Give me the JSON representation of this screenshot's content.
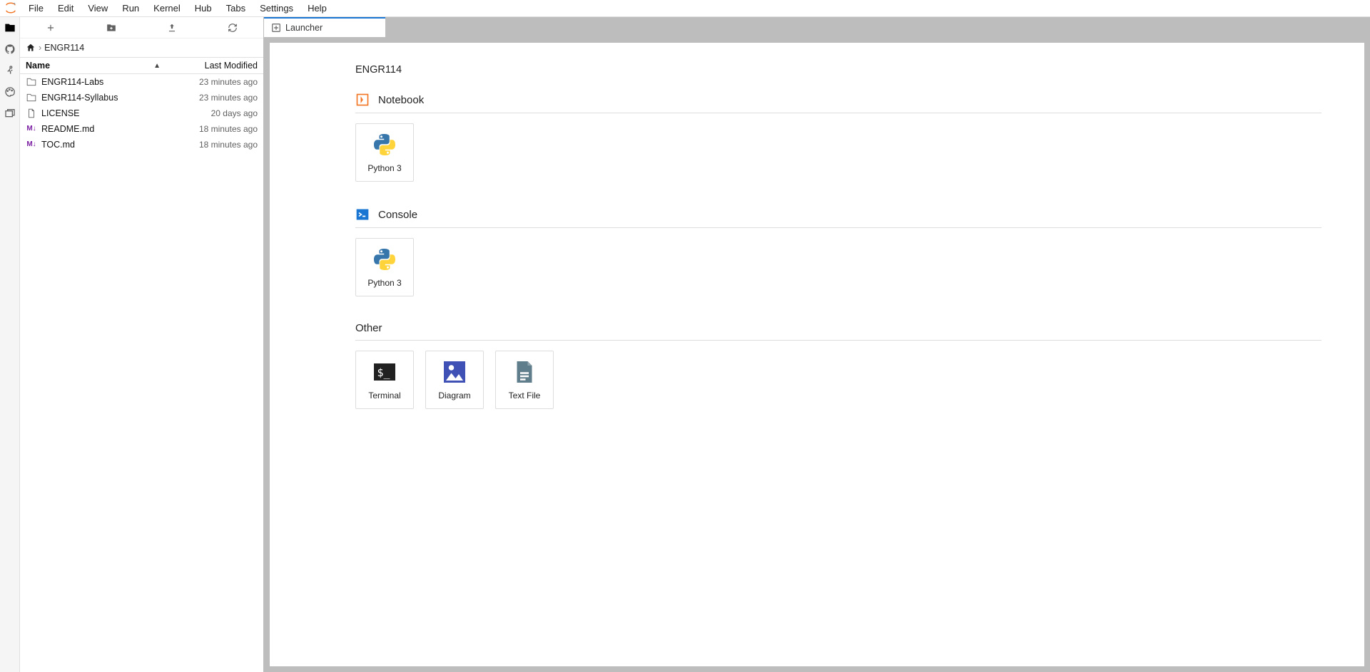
{
  "menu": {
    "items": [
      "File",
      "Edit",
      "View",
      "Run",
      "Kernel",
      "Hub",
      "Tabs",
      "Settings",
      "Help"
    ]
  },
  "activity": {
    "icons": [
      "folder",
      "github",
      "running",
      "palette",
      "tab"
    ]
  },
  "file_toolbar": {
    "icons": [
      "add",
      "new-folder",
      "upload",
      "refresh"
    ]
  },
  "breadcrumbs": {
    "home_icon": "home",
    "folder": "ENGR114"
  },
  "file_header": {
    "name": "Name",
    "modified": "Last Modified"
  },
  "files": [
    {
      "icon": "folder",
      "name": "ENGR114-Labs",
      "modified": "23 minutes ago"
    },
    {
      "icon": "folder",
      "name": "ENGR114-Syllabus",
      "modified": "23 minutes ago"
    },
    {
      "icon": "file",
      "name": "LICENSE",
      "modified": "20 days ago"
    },
    {
      "icon": "md",
      "name": "README.md",
      "modified": "18 minutes ago"
    },
    {
      "icon": "md",
      "name": "TOC.md",
      "modified": "18 minutes ago"
    }
  ],
  "tab": {
    "label": "Launcher"
  },
  "launcher": {
    "path": "ENGR114",
    "sections": [
      {
        "icon": "notebook",
        "title": "Notebook",
        "cards": [
          {
            "icon": "python",
            "label": "Python 3"
          }
        ]
      },
      {
        "icon": "console",
        "title": "Console",
        "cards": [
          {
            "icon": "python",
            "label": "Python 3"
          }
        ]
      },
      {
        "icon": "other",
        "title": "Other",
        "cards": [
          {
            "icon": "terminal",
            "label": "Terminal"
          },
          {
            "icon": "diagram",
            "label": "Diagram"
          },
          {
            "icon": "textfile",
            "label": "Text File"
          }
        ]
      }
    ]
  }
}
